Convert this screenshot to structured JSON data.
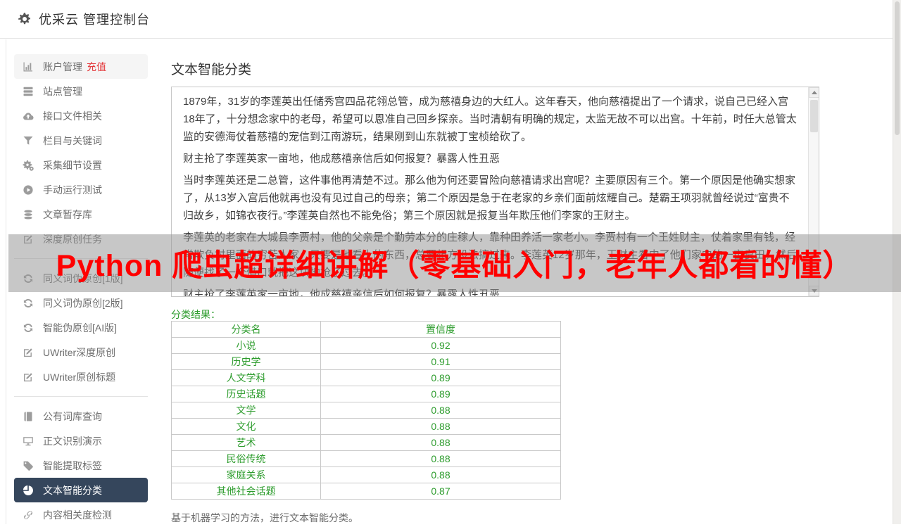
{
  "header": {
    "title": "优采云 管理控制台"
  },
  "sidebar": {
    "items": [
      {
        "label": "账户管理",
        "badge": "充值",
        "icon": "bar-chart-icon",
        "highlight": true
      },
      {
        "label": "站点管理",
        "icon": "server-icon"
      },
      {
        "label": "接口文件相关",
        "icon": "cloud-upload-icon"
      },
      {
        "label": "栏目与关键词",
        "icon": "filter-icon"
      },
      {
        "label": "采集细节设置",
        "icon": "gears-icon"
      },
      {
        "label": "手动运行测试",
        "icon": "play-icon"
      },
      {
        "label": "文章暂存库",
        "icon": "database-icon"
      },
      {
        "label": "深度原创任务",
        "icon": "edit-icon",
        "divider_after": true
      },
      {
        "label": "同义词伪原创[1版]",
        "icon": "refresh-icon"
      },
      {
        "label": "同义词伪原创[2版]",
        "icon": "refresh-icon"
      },
      {
        "label": "智能伪原创[AI版]",
        "icon": "refresh-icon"
      },
      {
        "label": "UWriter深度原创",
        "icon": "edit-icon"
      },
      {
        "label": "UWriter原创标题",
        "icon": "edit-icon",
        "divider_after": true
      },
      {
        "label": "公有词库查询",
        "icon": "book-icon"
      },
      {
        "label": "正文识别演示",
        "icon": "monitor-icon"
      },
      {
        "label": "智能提取标签",
        "icon": "tag-icon"
      },
      {
        "label": "文本智能分类",
        "icon": "pie-chart-icon",
        "active": true
      },
      {
        "label": "内容相关度检测",
        "icon": "link-icon"
      }
    ]
  },
  "main": {
    "title": "文本智能分类",
    "document": {
      "paragraphs": [
        "1879年，31岁的李莲英出任储秀宫四品花翎总管，成为慈禧身边的大红人。这年春天，他向慈禧提出了一个请求，说自己已经入宫18年了，十分想念家中的老母，希望可以恩准自己回乡探亲。当时清朝有明确的规定，太监无故不可以出宫。十年前，时任大总管太监的安德海仗着慈禧的宠信到江南游玩，结果刚到山东就被丁宝桢给砍了。",
        "财主抢了李莲英家一亩地，他成慈禧亲信后如何报复？暴露人性丑恶",
        "当时李莲英还是二总管，这件事他再清楚不过。那么他为何还要冒险向慈禧请求出宫呢？主要原因有三个。第一个原因是他确实想家了，从13岁入宫后他就再也没有见过自己的母亲；第二个原因是急于在老家的乡亲们面前炫耀自己。楚霸王项羽就曾经说过“富贵不归故乡，如锦衣夜行。”李莲英自然也不能免俗；第三个原因就是报复当年欺压他们李家的王财主。",
        "李莲英的老家在大城县李贾村，他的父亲是个勤劳本分的庄稼人，靠种田养活一家老小。李贾村有一个王姓财主，仗着家里有钱，经常欺负村里面的穷苦人家，只要是他看上的东西，总要想方设法搞过来。李莲英12岁那年，王财主看中了他们家中的一亩良田，然后随便找了一个借口就把这块地抢了过去。",
        "财主抢了李莲英家一亩地，他成慈禧亲信后如何报复？暴露人性丑恶"
      ]
    },
    "results": {
      "label": "分类结果：",
      "columns": [
        "分类名",
        "置信度"
      ],
      "rows": [
        [
          "小说",
          "0.92"
        ],
        [
          "历史学",
          "0.91"
        ],
        [
          "人文学科",
          "0.89"
        ],
        [
          "历史话题",
          "0.89"
        ],
        [
          "文学",
          "0.88"
        ],
        [
          "文化",
          "0.88"
        ],
        [
          "艺术",
          "0.88"
        ],
        [
          "民俗传统",
          "0.88"
        ],
        [
          "家庭关系",
          "0.88"
        ],
        [
          "其他社会话题",
          "0.87"
        ]
      ]
    },
    "footnote": "基于机器学习的方法，进行文本智能分类。"
  },
  "watermark": {
    "text": "Python 爬虫超详细讲解（零基础入门，老年人都看的懂）"
  },
  "colors": {
    "accent_green": "#2d9c2d",
    "badge_red": "#e4393c",
    "active_navy": "#35465c",
    "watermark_red": "#ff0000"
  }
}
